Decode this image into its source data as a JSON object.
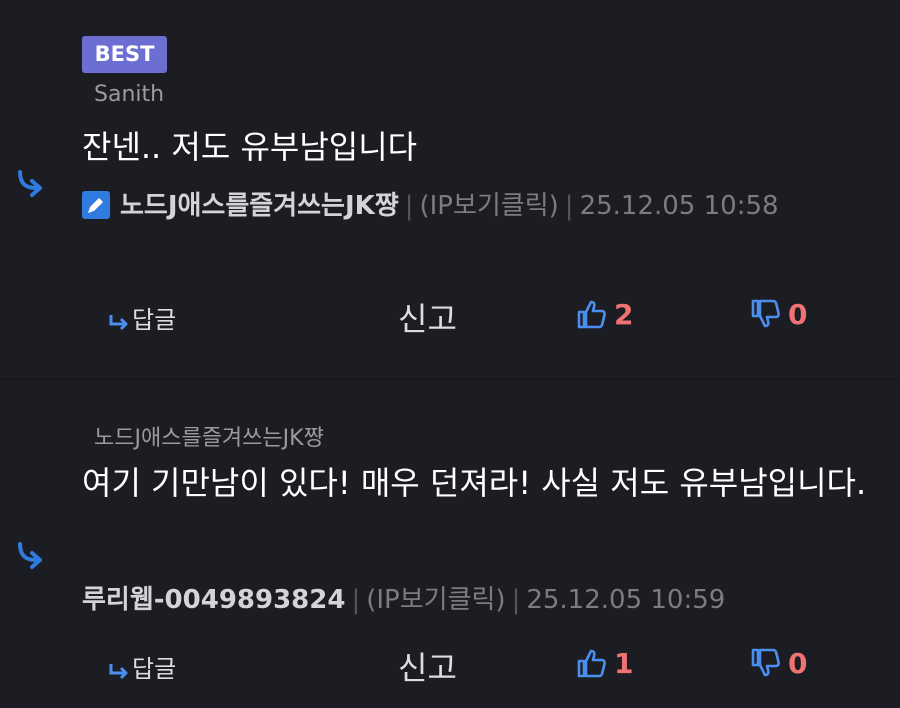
{
  "colors": {
    "background": "#1c1d22",
    "best_badge": "#6c6fd1",
    "accent_blue": "#2f7be0",
    "vote_count": "#f07373"
  },
  "comments": [
    {
      "badge": "BEST",
      "quoted_user": "Sanith",
      "content": "잔넨.. 저도 유부남입니다",
      "author": "노드J애스를즐겨쓰는JK쨩",
      "author_icon": "edit-icon",
      "ip_label": "(IP보기클릭)",
      "timestamp": "25.12.05 10:58",
      "reply_label": "답글",
      "report_label": "신고",
      "upvotes": "2",
      "downvotes": "0"
    },
    {
      "quoted_user": "노드J애스를즐겨쓰는JK쨩",
      "content": "여기 기만남이 있다! 매우 던져라! 사실 저도 유부남입니다.",
      "author": "루리웹-0049893824",
      "ip_label": "(IP보기클릭)",
      "timestamp": "25.12.05 10:59",
      "reply_label": "답글",
      "report_label": "신고",
      "upvotes": "1",
      "downvotes": "0"
    }
  ]
}
